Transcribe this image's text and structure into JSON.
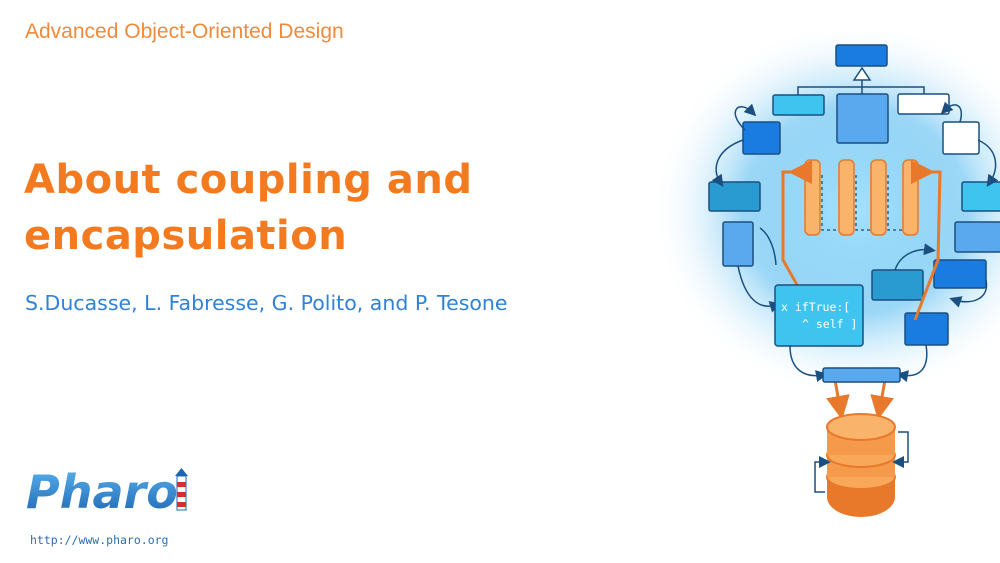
{
  "slide": {
    "course_title": "Advanced Object-Oriented Design",
    "title_line1": "About coupling and",
    "title_line2": "encapsulation",
    "authors": "S.Ducasse, L. Fabresse, G. Polito, and P. Tesone",
    "logo_text": "Pharo",
    "url": "http://www.pharo.org"
  },
  "illustration": {
    "code_line1": "x ifTrue:[",
    "code_line2": "^ self ]"
  },
  "colors": {
    "orange": "#f47a20",
    "blue": "#2f82d6",
    "dark_blue": "#1f5fa0",
    "light_blue": "#3fc4f0"
  }
}
